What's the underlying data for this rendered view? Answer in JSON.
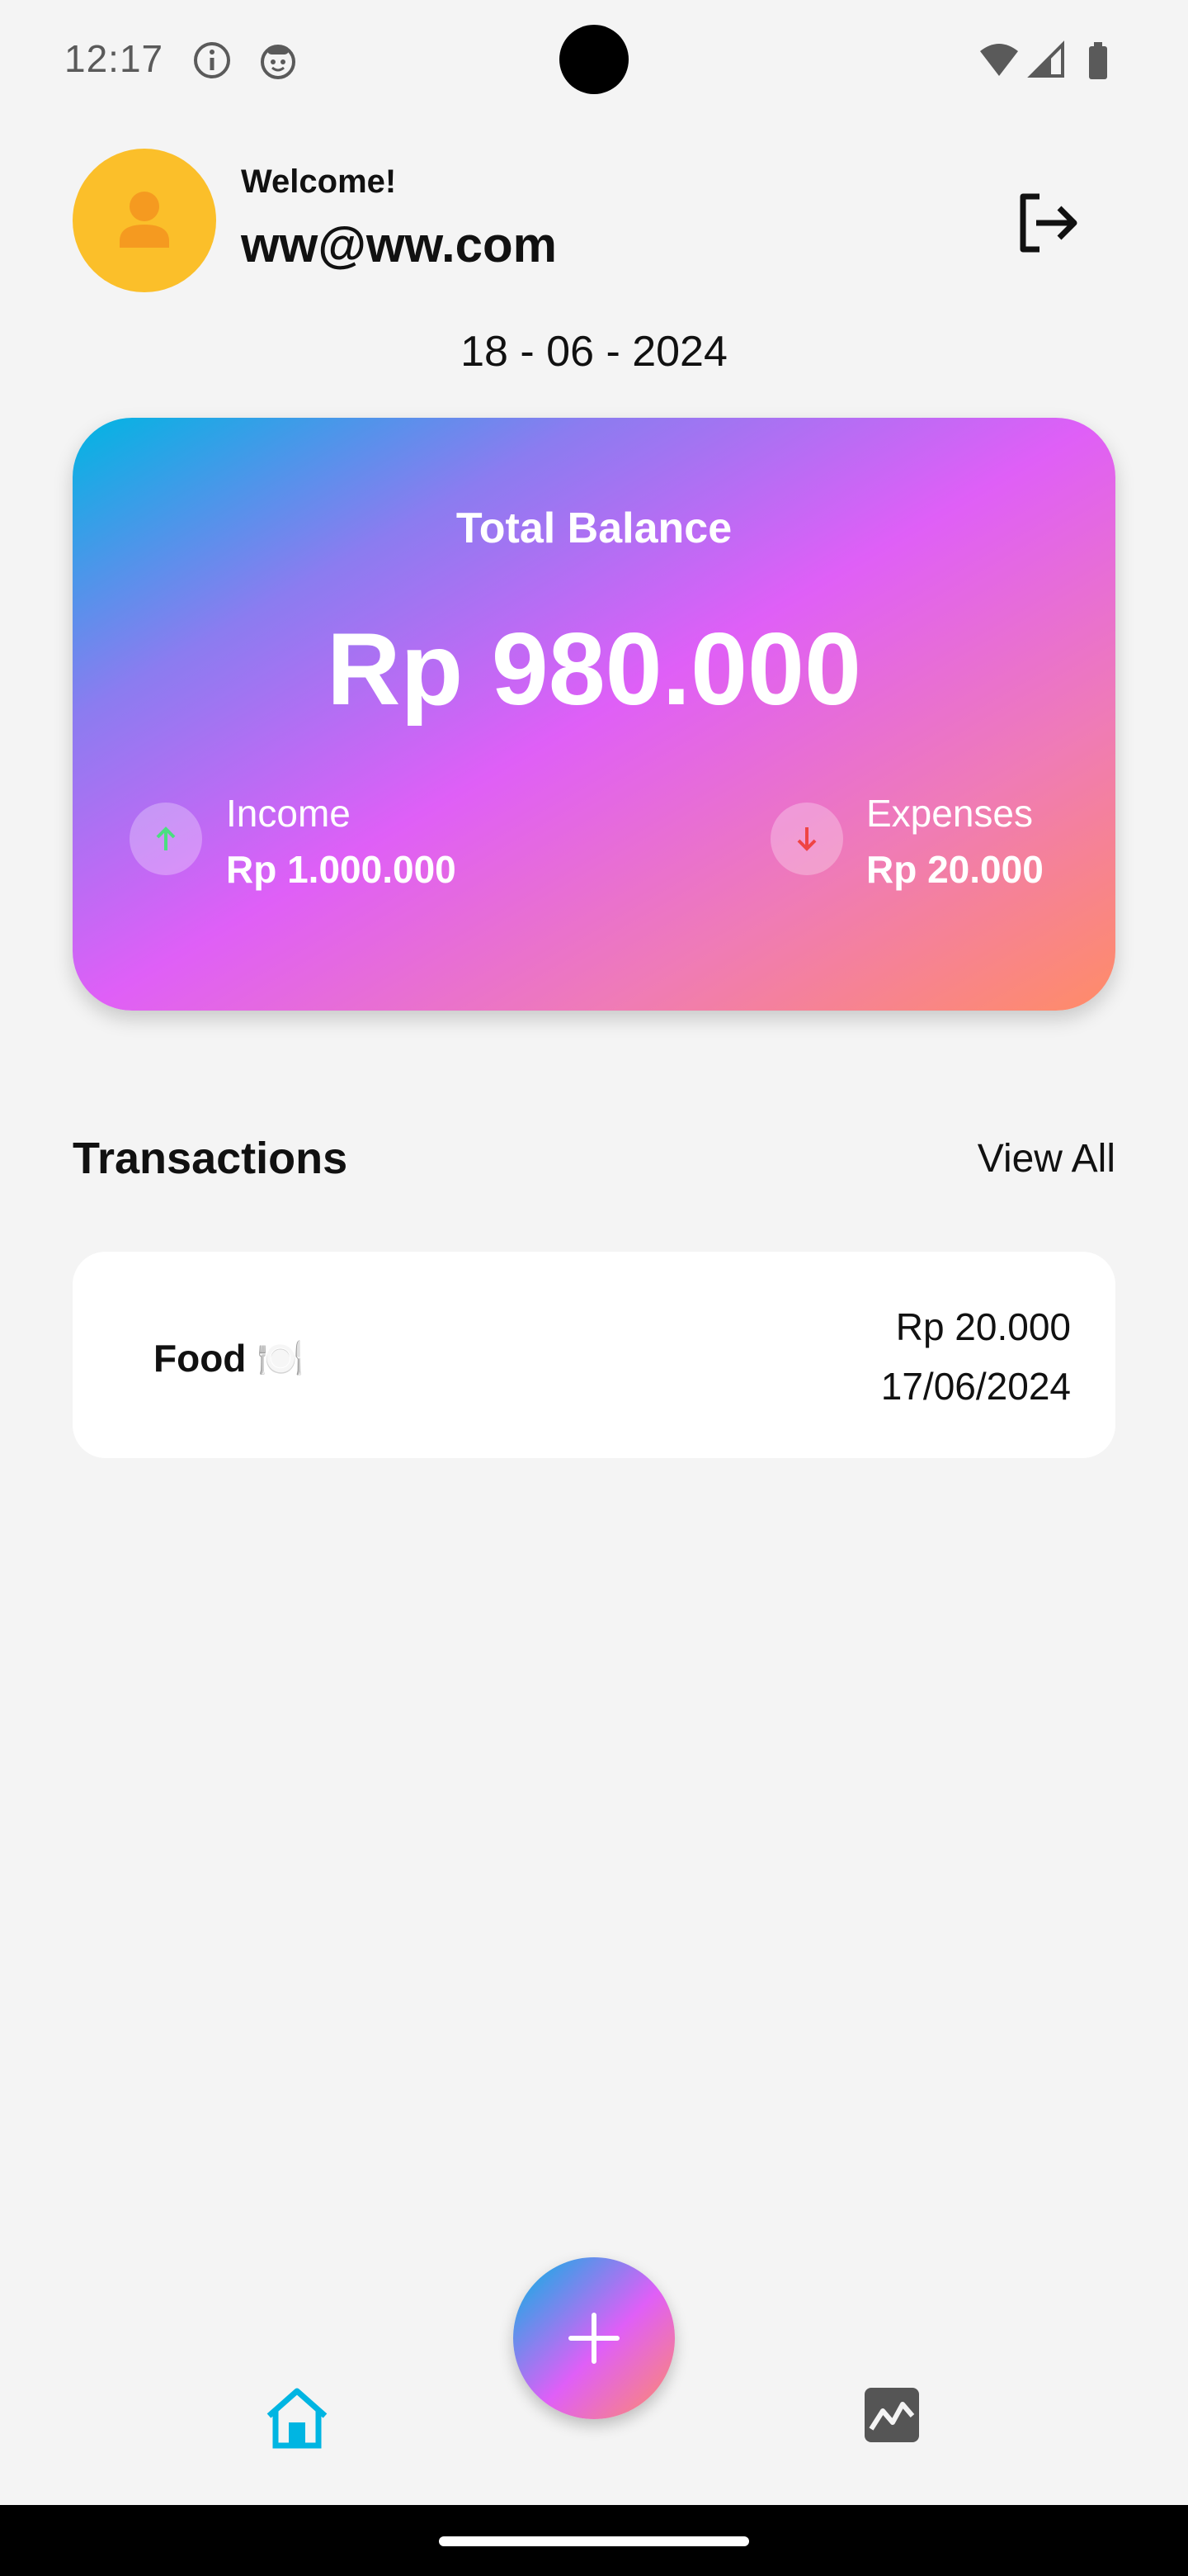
{
  "status_bar": {
    "time": "12:17",
    "icons": [
      "info-icon",
      "smiley-icon",
      "wifi-icon",
      "signal-icon",
      "battery-icon"
    ]
  },
  "header": {
    "welcome": "Welcome!",
    "email": "ww@ww.com",
    "avatar_icon": "person-icon",
    "logout_icon": "logout-icon"
  },
  "date": "18 - 06 - 2024",
  "balance_card": {
    "title": "Total Balance",
    "amount": "Rp 980.000",
    "income": {
      "label": "Income",
      "amount": "Rp 1.000.000",
      "icon": "arrow-up-icon",
      "color": "#4ade80"
    },
    "expenses": {
      "label": "Expenses",
      "amount": "Rp 20.000",
      "icon": "arrow-down-icon",
      "color": "#ef4444"
    }
  },
  "transactions": {
    "title": "Transactions",
    "view_all": "View All",
    "items": [
      {
        "name": "Food 🍽️",
        "amount": "Rp 20.000",
        "date": "17/06/2024"
      }
    ]
  },
  "bottom_nav": {
    "items": [
      {
        "icon": "home-icon",
        "active": true,
        "color": "#00b5e2"
      },
      {
        "icon": "stats-icon",
        "active": false,
        "color": "#555555"
      }
    ],
    "fab_icon": "plus-icon"
  },
  "colors": {
    "background": "#f4f4f4",
    "avatar": "#fbbf2a",
    "accent": "#00b5e2"
  }
}
